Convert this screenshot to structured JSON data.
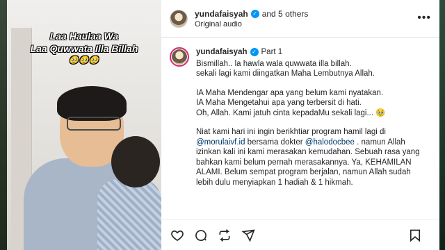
{
  "media": {
    "caption_line1": "Laa Haulaa Wa",
    "caption_line2": "Laa Quwwata Illa Billah",
    "caption_emoji": "🥹🥹🥹"
  },
  "header": {
    "username": "yundafaisyah",
    "collab_text": "and 5 others",
    "audio": "Original audio"
  },
  "comment": {
    "username": "yundafaisyah",
    "part": "Part 1",
    "paragraphs": [
      [
        "Bismillah.. la hawla wala quwwata illa billah.",
        "sekali lagi kami diingatkan Maha Lembutnya Allah."
      ],
      [
        "IA Maha Mendengar apa yang belum kami nyatakan.",
        "IA Maha Mengetahui apa yang terbersit di hati.",
        "Oh, Allah. Kami jatuh cinta kepadaMu sekali lagi... 🥹"
      ]
    ],
    "p3_a": "Niat kami hari ini ingin berikhtiar program hamil lagi di",
    "mention1": "@morulaivf.id",
    "p3_b": " bersama dokter ",
    "mention2": "@halodocbee",
    "p3_c": " . namun Allah",
    "p3_lines": [
      "izinkan kali ini kami merasakan kemudahan. Sebuah rasa yang",
      "bahkan kami belum pernah merasakannya. Ya, KEHAMILAN",
      "ALAMI. Belum sempat program berjalan, namun Allah sudah",
      "lebih dulu menyiapkan 1 hadiah & 1 hikmah."
    ]
  },
  "icons": {
    "more": "more-options-icon",
    "like": "heart-icon",
    "comment": "comment-icon",
    "share": "repost-icon",
    "send": "send-icon",
    "save": "bookmark-icon"
  },
  "colors": {
    "verified": "#0095f6",
    "mention": "#00376b",
    "story_ring": "#d62976"
  }
}
